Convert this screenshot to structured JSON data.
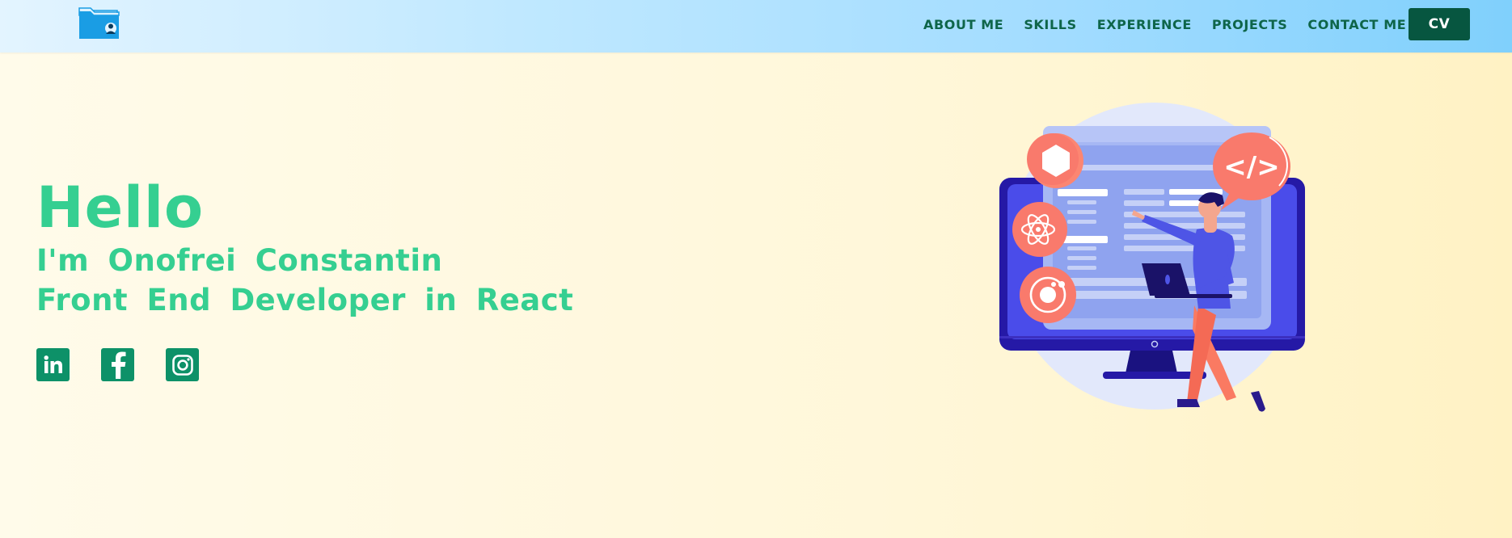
{
  "nav": {
    "logo_icon": "folder-user-icon",
    "links": [
      "ABOUT ME",
      "SKILLS",
      "EXPERIENCE",
      "PROJECTS",
      "CONTACT ME"
    ],
    "cv_label": "CV"
  },
  "hero": {
    "greeting": "Hello",
    "intro": "I'm Onofrei Constantin",
    "role": "Front End Developer in React"
  },
  "socials": {
    "icons": [
      "linkedin-icon",
      "facebook-icon",
      "instagram-icon"
    ]
  },
  "illustration": {
    "icon": "developer-at-monitor-illustration",
    "code_bubble_text": "</>"
  },
  "colors": {
    "accent_green": "#35cf91",
    "dark_green": "#075640",
    "social_green": "#0d9168",
    "nav_text": "#0e6549",
    "monitor_blue": "#3a3fe0",
    "coral": "#fc8672"
  }
}
